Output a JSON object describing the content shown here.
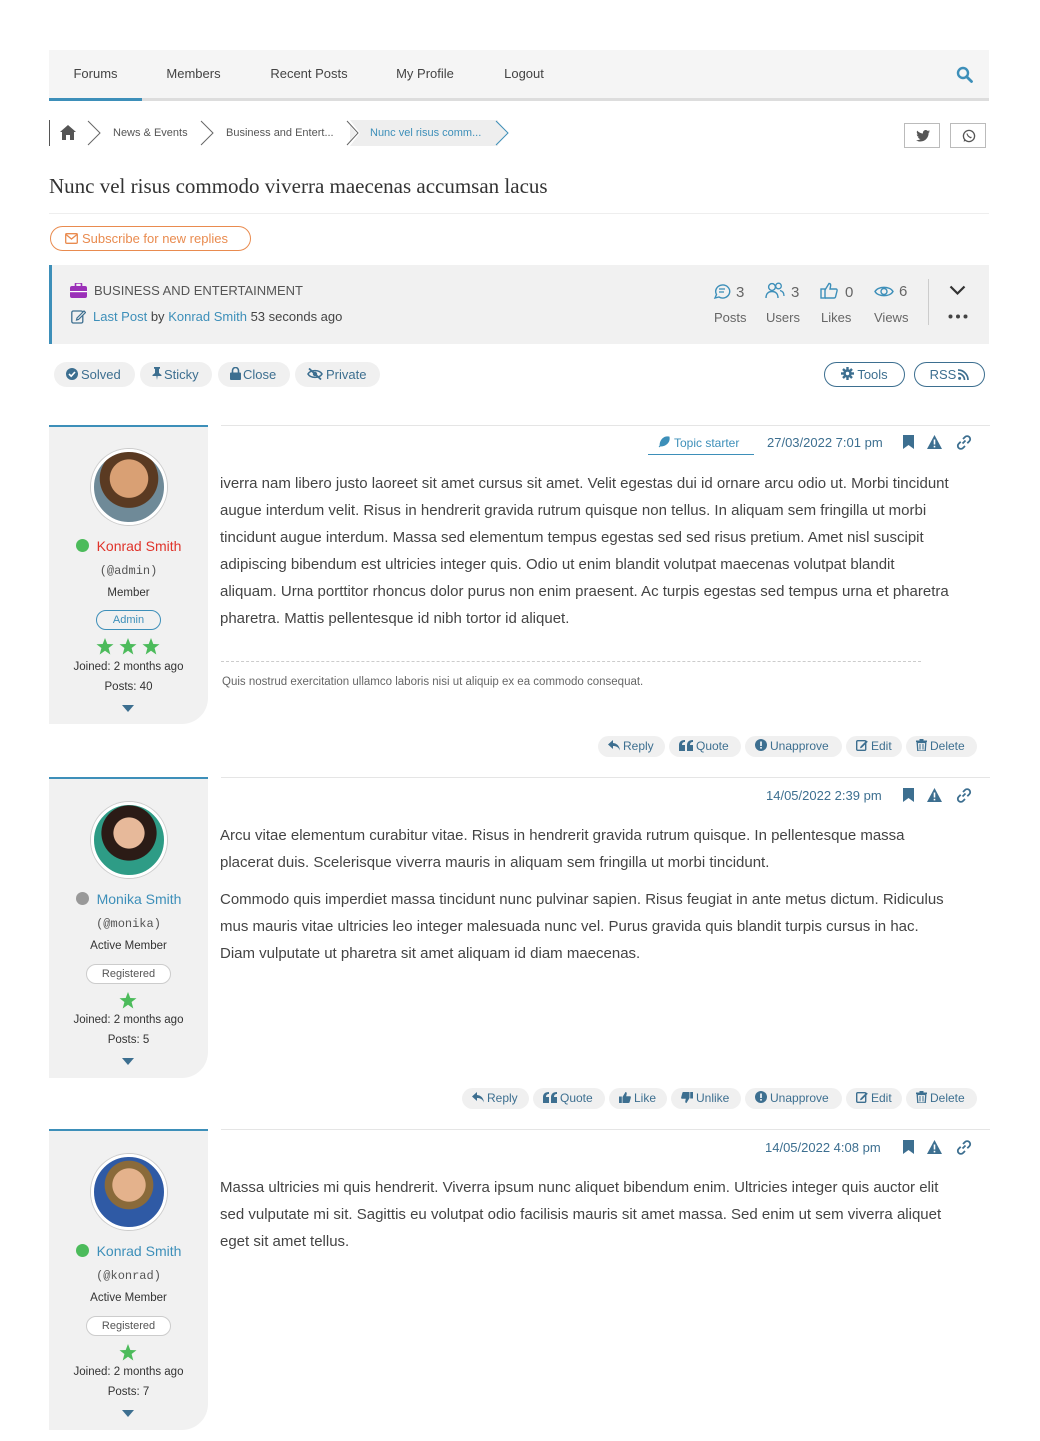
{
  "nav": {
    "items": [
      "Forums",
      "Members",
      "Recent Posts",
      "My Profile",
      "Logout"
    ]
  },
  "breadcrumb": {
    "items": [
      "News & Events",
      "Business and Entert...",
      "Nunc vel risus comm..."
    ]
  },
  "topic": {
    "title": "Nunc vel risus commodo viverra maecenas accumsan lacus",
    "subscribe_label": "Subscribe for new replies"
  },
  "info": {
    "forum": "BUSINESS AND ENTERTAINMENT",
    "last_post_label": "Last Post",
    "by_label": "by",
    "last_post_author": "Konrad Smith",
    "last_post_time": "53 seconds ago",
    "stats": [
      {
        "value": "3",
        "label": "Posts"
      },
      {
        "value": "3",
        "label": "Users"
      },
      {
        "value": "0",
        "label": "Likes"
      },
      {
        "value": "6",
        "label": "Views"
      }
    ]
  },
  "status_buttons": [
    "Solved",
    "Sticky",
    "Close",
    "Private"
  ],
  "tools": {
    "tools_label": "Tools",
    "rss_label": "RSS"
  },
  "colors": {
    "accent": "#3d8fb9",
    "online": "#4cbb5b",
    "offline": "#999999",
    "admin_name": "#e0342b",
    "orange": "#e98b4f",
    "star": "#4cbb5b"
  },
  "posts": [
    {
      "author": "Konrad Smith",
      "handle": "(@admin)",
      "rank": "Member",
      "badge": "Admin",
      "online": true,
      "stars": 3,
      "joined": "Joined: 2 months ago",
      "post_count": "Posts: 40",
      "starter_label": "Topic starter",
      "date": "27/03/2022 7:01 pm",
      "paragraphs": [
        "iverra nam libero justo laoreet sit amet cursus sit amet. Velit egestas dui id ornare arcu odio ut. Morbi tincidunt augue interdum velit. Risus in hendrerit gravida rutrum quisque non tellus. In aliquam sem fringilla ut morbi tincidunt augue interdum. Massa sed elementum tempus egestas sed sed risus pretium. Amet nisl suscipit adipiscing bibendum est ultricies integer quis. Odio ut enim blandit volutpat maecenas volutpat blandit aliquam. Urna porttitor rhoncus dolor purus non enim praesent. Ac turpis egestas sed tempus urna et pharetra pharetra. Mattis pellentesque id nibh tortor id aliquet."
      ],
      "signature": "Quis nostrud exercitation ullamco laboris nisi ut aliquip ex ea commodo consequat.",
      "actions": [
        "Reply",
        "Quote",
        "Unapprove",
        "Edit",
        "Delete"
      ]
    },
    {
      "author": "Monika Smith",
      "handle": "(@monika)",
      "rank": "Active Member",
      "badge": "Registered",
      "online": false,
      "stars": 1,
      "joined": "Joined: 2 months ago",
      "post_count": "Posts: 5",
      "date": "14/05/2022 2:39 pm",
      "paragraphs": [
        "Arcu vitae elementum curabitur vitae. Risus in hendrerit gravida rutrum quisque. In pellentesque massa placerat duis. Scelerisque viverra mauris in aliquam sem fringilla ut morbi tincidunt.",
        "Commodo quis imperdiet massa tincidunt nunc pulvinar sapien. Risus feugiat in ante metus dictum. Ridiculus mus mauris vitae ultricies leo integer malesuada nunc vel. Purus gravida quis blandit turpis cursus in hac. Diam vulputate ut pharetra sit amet aliquam id diam maecenas."
      ],
      "actions": [
        "Reply",
        "Quote",
        "Like",
        "Unlike",
        "Unapprove",
        "Edit",
        "Delete"
      ]
    },
    {
      "author": "Konrad Smith",
      "handle": "(@konrad)",
      "rank": "Active Member",
      "badge": "Registered",
      "online": true,
      "stars": 1,
      "joined": "Joined: 2 months ago",
      "post_count": "Posts: 7",
      "date": "14/05/2022 4:08 pm",
      "paragraphs": [
        "Massa ultricies mi quis hendrerit. Viverra ipsum nunc aliquet bibendum enim. Ultricies integer quis auctor elit sed vulputate mi sit. Sagittis eu volutpat odio facilisis mauris sit amet massa. Sed enim ut sem viverra aliquet eget sit amet tellus."
      ]
    }
  ]
}
